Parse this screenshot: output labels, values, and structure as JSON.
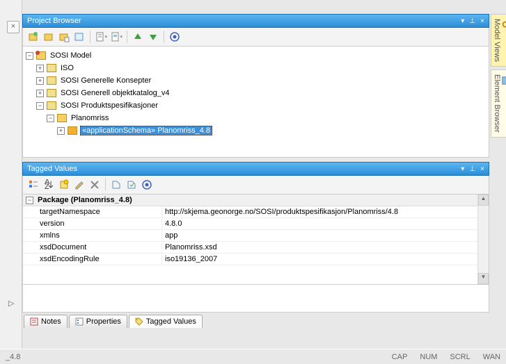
{
  "panels": {
    "projectBrowser": {
      "title": "Project Browser"
    },
    "taggedValues": {
      "title": "Tagged Values"
    }
  },
  "tree": {
    "root": "SOSI Model",
    "nodes": [
      {
        "label": "ISO",
        "indent": 1
      },
      {
        "label": "SOSI Generelle Konsepter",
        "indent": 1
      },
      {
        "label": "SOSI Generell objektkatalog_v4",
        "indent": 1
      },
      {
        "label": "SOSI Produktspesifikasjoner",
        "indent": 1,
        "expanded": true
      },
      {
        "label": "Planomriss",
        "indent": 2,
        "expanded": true
      },
      {
        "label": "«applicationSchema» Planomriss_4.8",
        "indent": 3,
        "selected": true
      }
    ]
  },
  "tagged": {
    "header": "Package (Planomriss_4.8)",
    "rows": [
      {
        "key": "targetNamespace",
        "value": "http://skjema.geonorge.no/SOSI/produktspesifikasjon/Planomriss/4.8"
      },
      {
        "key": "version",
        "value": "4.8.0"
      },
      {
        "key": "xmlns",
        "value": "app"
      },
      {
        "key": "xsdDocument",
        "value": "Planomriss.xsd"
      },
      {
        "key": "xsdEncodingRule",
        "value": "iso19136_2007"
      }
    ]
  },
  "tabs": {
    "notes": "Notes",
    "properties": "Properties",
    "taggedValues": "Tagged Values"
  },
  "status": {
    "left": "_4.8",
    "cap": "CAP",
    "num": "NUM",
    "scrl": "SCRL",
    "wan": "WAN"
  },
  "sideTabs": {
    "modelViews": "Model Views",
    "elementBrowser": "Element Browser"
  }
}
